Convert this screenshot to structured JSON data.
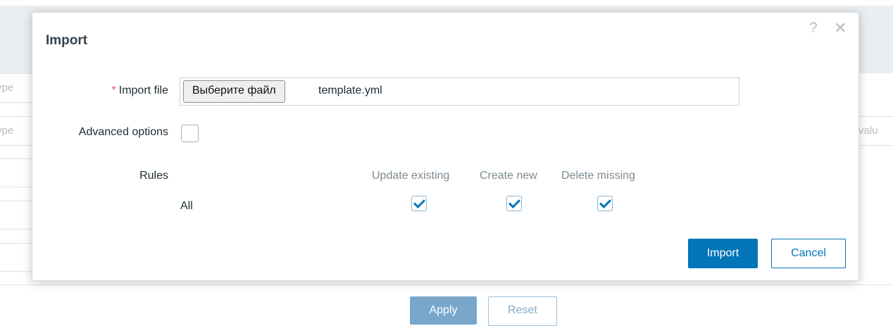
{
  "background": {
    "filter_placeholder_1": "ype",
    "filter_placeholder_2": "ype",
    "filter_value_placeholder": "valu",
    "apply_label": "Apply",
    "reset_label": "Reset"
  },
  "dialog": {
    "title": "Import",
    "help_icon": "question-icon",
    "close_icon": "close-icon",
    "import_file": {
      "required_marker": "*",
      "label": "Import file",
      "choose_button": "Выберите файл",
      "file_name": "template.yml"
    },
    "advanced_options": {
      "label": "Advanced options",
      "checked": false
    },
    "rules": {
      "label": "Rules",
      "columns": [
        "Update existing",
        "Create new",
        "Delete missing"
      ],
      "rows": [
        {
          "label": "All",
          "update_existing": true,
          "create_new": true,
          "delete_missing": true
        }
      ]
    },
    "import_button": "Import",
    "cancel_button": "Cancel"
  },
  "colors": {
    "primary": "#0275b8",
    "required": "#e45959",
    "title": "#34444f"
  }
}
